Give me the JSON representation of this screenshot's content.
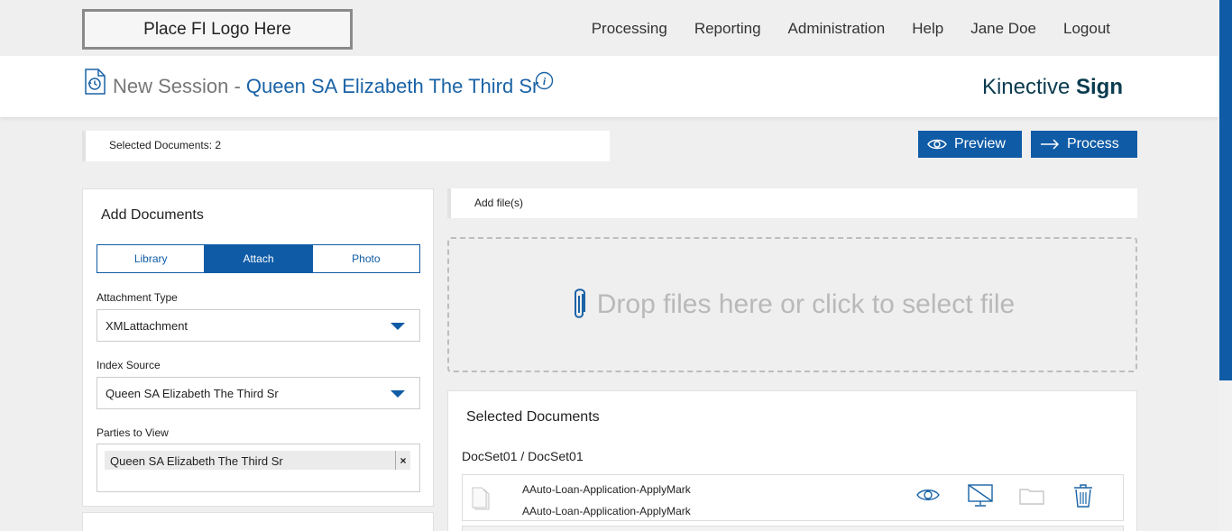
{
  "header": {
    "logo_text": "Place FI Logo Here",
    "nav": [
      "Processing",
      "Reporting",
      "Administration",
      "Help",
      "Jane Doe",
      "Logout"
    ]
  },
  "session": {
    "prefix": "New Session -",
    "name": "Queen SA Elizabeth The Third Sr",
    "brand_light": "Kinective",
    "brand_bold": "Sign"
  },
  "summary": {
    "text": "Selected Documents: 2"
  },
  "actions": {
    "preview": "Preview",
    "process": "Process"
  },
  "add_documents": {
    "title": "Add Documents",
    "tabs": [
      {
        "label": "Library",
        "active": false
      },
      {
        "label": "Attach",
        "active": true
      },
      {
        "label": "Photo",
        "active": false
      }
    ],
    "attachment_type_label": "Attachment Type",
    "attachment_type_value": "XMLattachment",
    "index_source_label": "Index Source",
    "index_source_value": "Queen SA Elizabeth The Third Sr",
    "parties_label": "Parties to View",
    "parties": [
      "Queen SA Elizabeth The Third Sr"
    ],
    "chip_remove": "×"
  },
  "upload": {
    "add_files_label": "Add file(s)",
    "drop_text": "Drop files here or click to select file"
  },
  "selected_documents": {
    "title": "Selected Documents",
    "docset": "DocSet01 / DocSet01",
    "documents": [
      {
        "line1": "AAuto-Loan-Application-ApplyMark",
        "line2": "AAuto-Loan-Application-ApplyMark"
      }
    ]
  },
  "colors": {
    "primary": "#0f5ba6",
    "brand_text": "#0b3b4f",
    "session_name": "#1a63a6"
  }
}
